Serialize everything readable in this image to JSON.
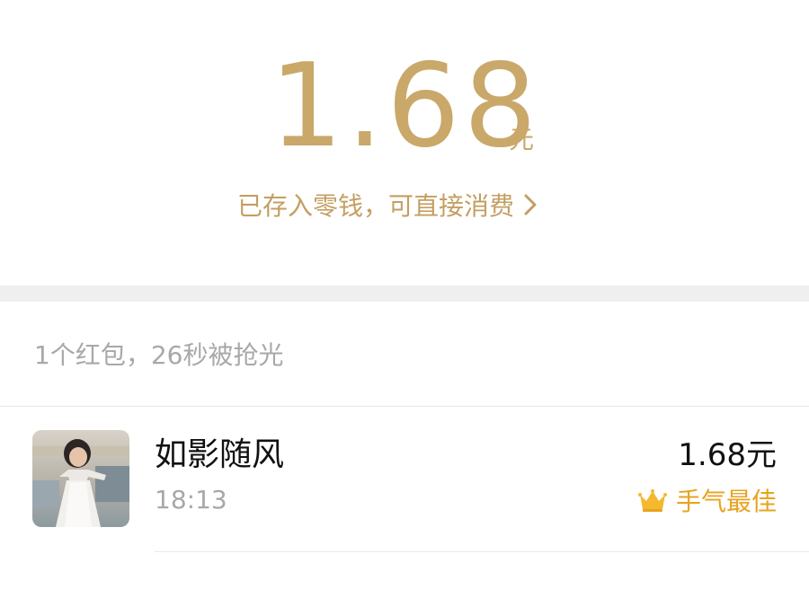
{
  "header": {
    "amount": "1.68",
    "unit": "元",
    "deposit_note": "已存入零钱，可直接消费",
    "chevron_icon": "chevron-right-icon",
    "accent_color": "#c9a86a"
  },
  "summary": {
    "text": "1个红包，26秒被抢光"
  },
  "records": [
    {
      "avatar_icon": "user-avatar-photo",
      "name": "如影随风",
      "time": "18:13",
      "amount": "1.68元",
      "badge_icon": "crown-icon",
      "badge_label": "手气最佳",
      "badge_color": "#e8a321"
    }
  ]
}
